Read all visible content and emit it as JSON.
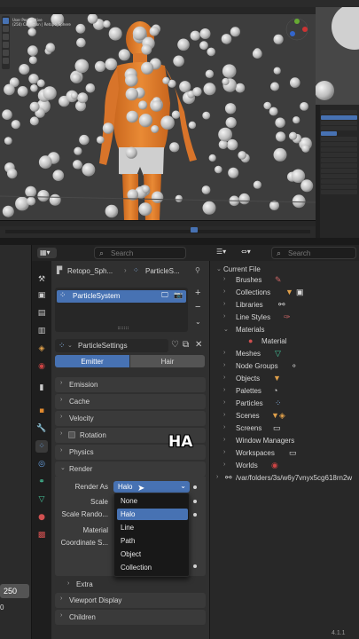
{
  "colors": {
    "accent": "#4772b3",
    "character_orange": "#e07d2a",
    "shorts_gray": "#cfcfcf",
    "viewport_bg": "#3d3d3d",
    "panel_bg": "#303030",
    "menu_bg": "#181818"
  },
  "viewport": {
    "info_line1": "User Perspective",
    "info_line2": "(250) Collection | Retopo_Sphere"
  },
  "properties": {
    "breadcrumb_object": "Retopo_Sph...",
    "breadcrumb_system": "ParticleS...",
    "search_placeholder": "Search",
    "particle_system_item": "ParticleSystem",
    "settings_name": "ParticleSettings",
    "type_tabs": [
      "Emitter",
      "Hair"
    ],
    "panels": {
      "emission": "Emission",
      "cache": "Cache",
      "velocity": "Velocity",
      "rotation": "Rotation",
      "physics": "Physics",
      "render": "Render",
      "extra": "Extra",
      "viewport_display": "Viewport Display",
      "children": "Children"
    },
    "render_rows": {
      "render_as": "Render As",
      "scale": "Scale",
      "scale_random": "Scale Rando...",
      "material": "Material",
      "coordinate_system": "Coordinate S..."
    },
    "render_as_value": "Halo",
    "dropdown_options": [
      "None",
      "Halo",
      "Line",
      "Path",
      "Object",
      "Collection"
    ],
    "dropdown_selected": "Halo"
  },
  "outliner": {
    "search_placeholder": "Search",
    "root": "Current File",
    "items": {
      "brushes": "Brushes",
      "collections": "Collections",
      "libraries": "Libraries",
      "line_styles": "Line Styles",
      "materials": "Materials",
      "material_child": "Material",
      "meshes": "Meshes",
      "node_groups": "Node Groups",
      "objects": "Objects",
      "palettes": "Palettes",
      "particles": "Particles",
      "scenes": "Scenes",
      "screens": "Screens",
      "window_managers": "Window Managers",
      "workspaces": "Workspaces",
      "worlds": "Worlds"
    },
    "path": "/var/folders/3s/w6y7vnyx5cg618rn2w"
  },
  "left_strip": {
    "frame_current": "250",
    "frame_start": "0"
  },
  "caption": "HA",
  "version": "4.1.1"
}
